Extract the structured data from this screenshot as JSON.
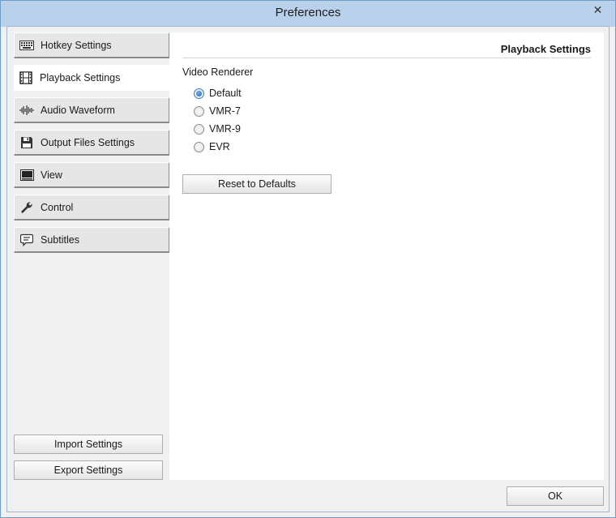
{
  "window": {
    "title": "Preferences",
    "close_symbol": "✕"
  },
  "sidebar": {
    "items": [
      {
        "label": "Hotkey Settings",
        "icon": "keyboard-icon"
      },
      {
        "label": "Playback Settings",
        "icon": "film-icon",
        "active": true
      },
      {
        "label": "Audio Waveform",
        "icon": "waveform-icon"
      },
      {
        "label": "Output Files Settings",
        "icon": "floppy-disk-icon"
      },
      {
        "label": "View",
        "icon": "view-icon"
      },
      {
        "label": "Control",
        "icon": "wrench-icon"
      },
      {
        "label": "Subtitles",
        "icon": "speech-bubble-icon"
      }
    ],
    "import_label": "Import Settings",
    "export_label": "Export Settings"
  },
  "content": {
    "title": "Playback Settings",
    "group_label": "Video Renderer",
    "options": [
      {
        "label": "Default",
        "checked": true
      },
      {
        "label": "VMR-7",
        "checked": false
      },
      {
        "label": "VMR-9",
        "checked": false
      },
      {
        "label": "EVR",
        "checked": false
      }
    ],
    "reset_label": "Reset to Defaults"
  },
  "footer": {
    "ok_label": "OK"
  },
  "colors": {
    "titlebar": "#b9d1ea",
    "radio_accent": "#1e5fb4"
  }
}
